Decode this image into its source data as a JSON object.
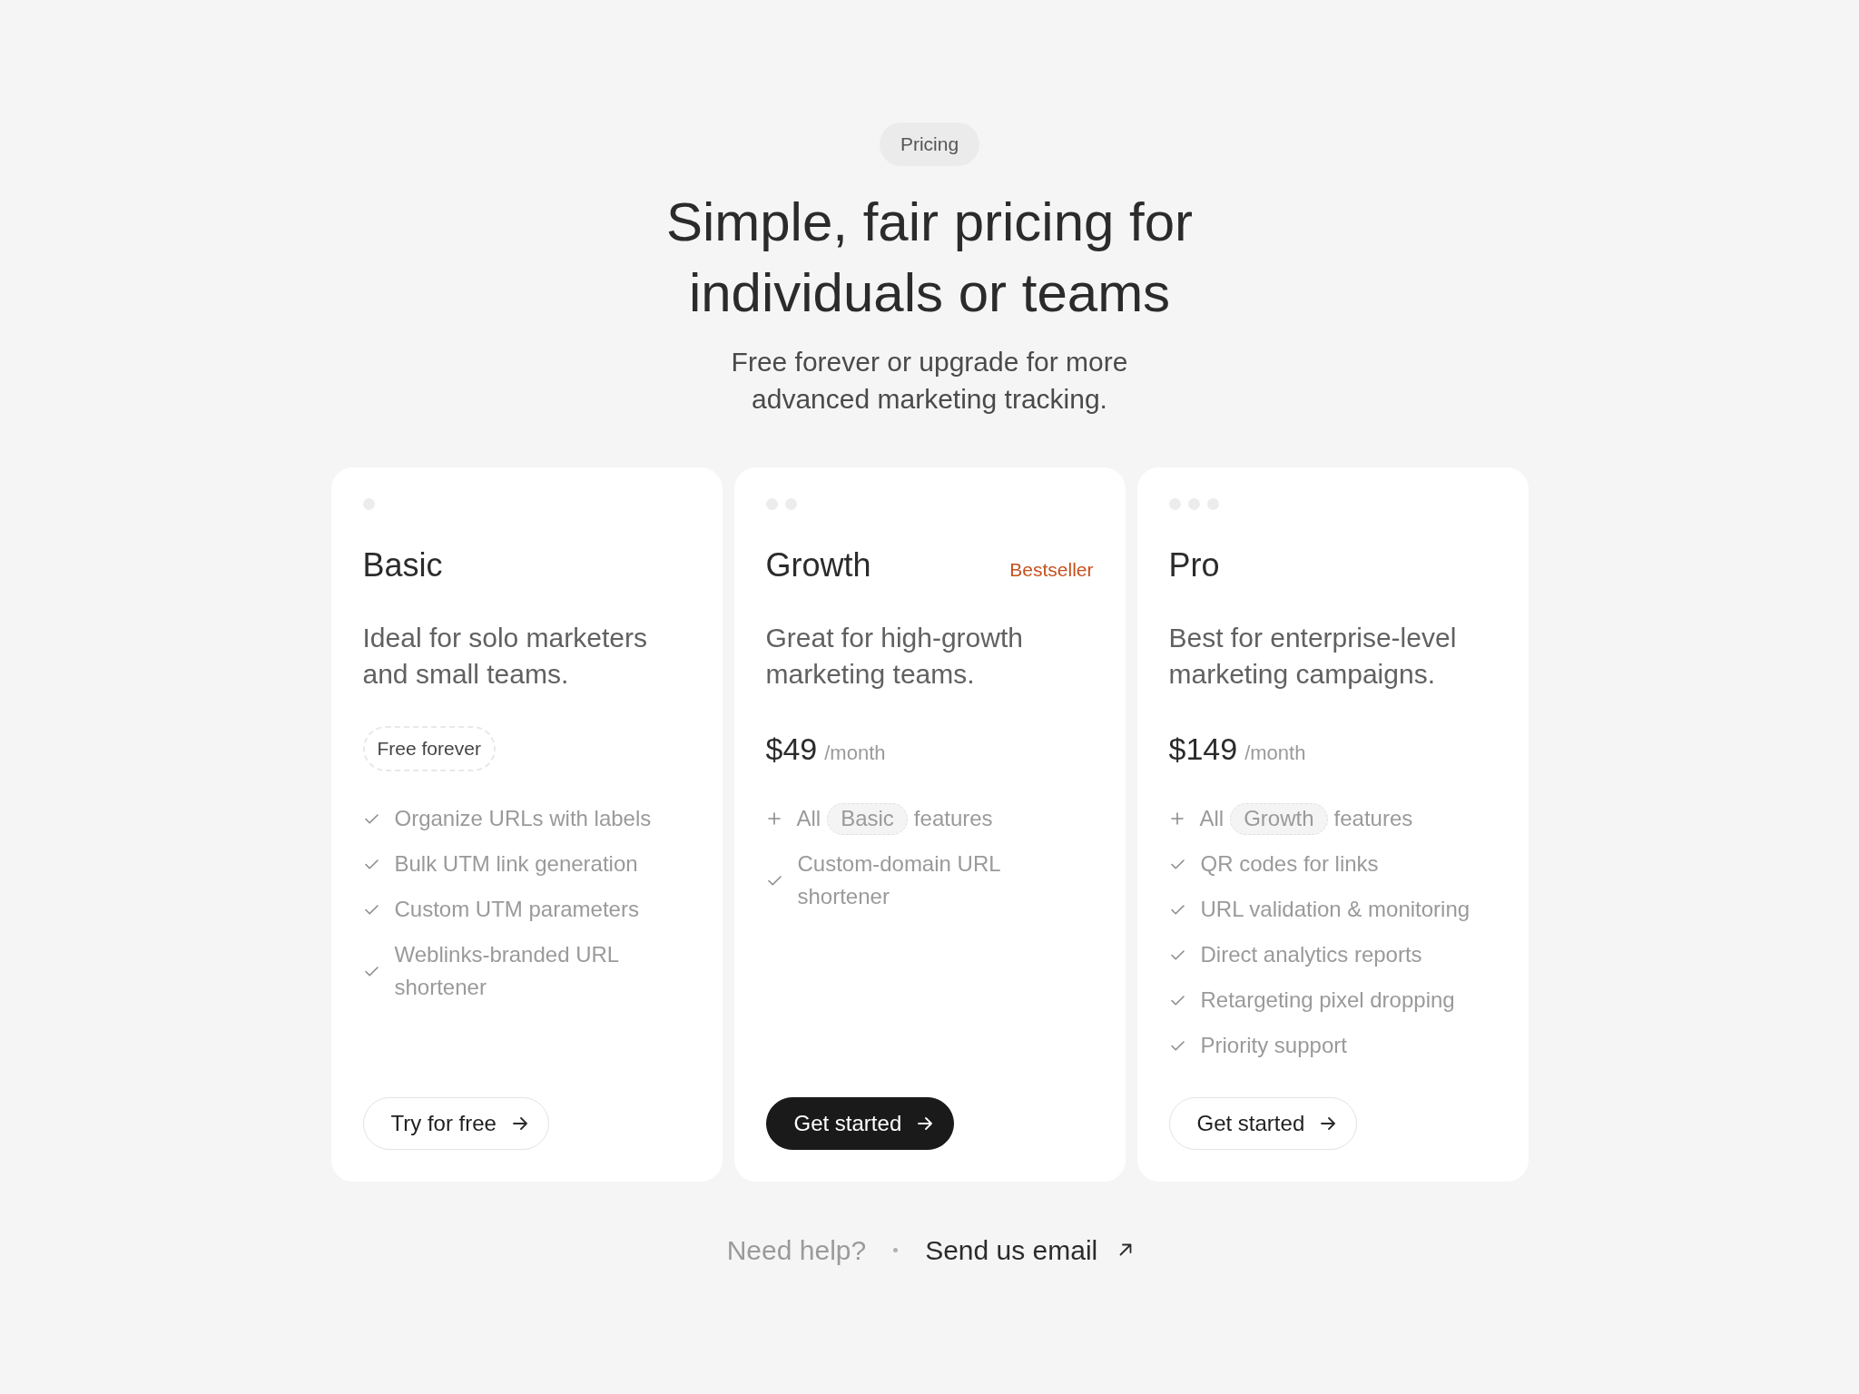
{
  "header": {
    "eyebrow": "Pricing",
    "title": "Simple, fair pricing for individuals or teams",
    "subtitle": "Free forever or upgrade for more advanced marketing tracking."
  },
  "plans": [
    {
      "name": "Basic",
      "description": "Ideal for solo marketers and small teams.",
      "offer": {
        "kind": "badge",
        "text": "Free forever"
      },
      "features": [
        {
          "kind": "check",
          "text": "Organize URLs with labels"
        },
        {
          "kind": "check",
          "text": "Bulk UTM link generation"
        },
        {
          "kind": "check",
          "text": "Custom UTM parameters"
        },
        {
          "kind": "check",
          "text": "Weblinks-branded URL shortener"
        }
      ],
      "button": {
        "label": "Try for free",
        "primary": false
      }
    },
    {
      "name": "Growth",
      "tag": "Bestseller",
      "description": "Great for high-growth marketing teams.",
      "offer": {
        "kind": "price",
        "amount": "$49",
        "period": "/month"
      },
      "features": [
        {
          "kind": "plus",
          "prefix": "All",
          "plan": "Basic",
          "suffix": "features"
        },
        {
          "kind": "check",
          "text": "Custom-domain URL shortener"
        }
      ],
      "button": {
        "label": "Get started",
        "primary": true
      }
    },
    {
      "name": "Pro",
      "description": "Best for enterprise-level marketing campaigns.",
      "offer": {
        "kind": "price",
        "amount": "$149",
        "period": "/month"
      },
      "features": [
        {
          "kind": "plus",
          "prefix": "All",
          "plan": "Growth",
          "suffix": "features"
        },
        {
          "kind": "check",
          "text": "QR codes for links"
        },
        {
          "kind": "check",
          "text": "URL validation & monitoring"
        },
        {
          "kind": "check",
          "text": "Direct analytics reports"
        },
        {
          "kind": "check",
          "text": "Retargeting pixel dropping"
        },
        {
          "kind": "check",
          "text": "Priority support"
        }
      ],
      "button": {
        "label": "Get started",
        "primary": false
      }
    }
  ],
  "footer": {
    "prompt": "Need help?",
    "link": "Send us email"
  }
}
